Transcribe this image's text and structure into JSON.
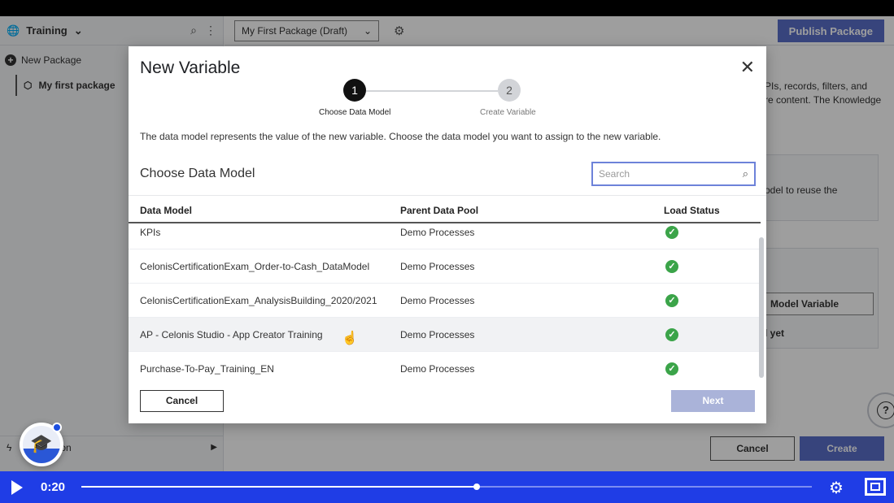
{
  "sidebar": {
    "workspace": "Training",
    "new_package": "New Package",
    "package_item": "My first package",
    "bottom_item": "on"
  },
  "topbar": {
    "package_select": "My First Package (Draft)",
    "publish": "Publish Package"
  },
  "background": {
    "text1a": "PIs, records, filters, and",
    "text1b": "re content. The Knowledge",
    "text2": "odel to reuse the",
    "model_variable_btn": "Model Variable",
    "empty_text": "l yet",
    "cancel": "Cancel",
    "create": "Create"
  },
  "modal": {
    "title": "New Variable",
    "steps": [
      {
        "num": "1",
        "label": "Choose Data Model"
      },
      {
        "num": "2",
        "label": "Create Variable"
      }
    ],
    "description": "The data model represents the value of the new variable. Choose the data model you want to assign to the new variable.",
    "subtitle": "Choose Data Model",
    "search_placeholder": "Search",
    "columns": [
      "Data Model",
      "Parent Data Pool",
      "Load Status"
    ],
    "rows": [
      {
        "model": "KPIs",
        "pool": "Demo Processes",
        "status": "loaded"
      },
      {
        "model": "CelonisCertificationExam_Order-to-Cash_DataModel",
        "pool": "Demo Processes",
        "status": "loaded"
      },
      {
        "model": "CelonisCertificationExam_AnalysisBuilding_2020/2021",
        "pool": "Demo Processes",
        "status": "loaded"
      },
      {
        "model": "AP - Celonis Studio - App Creator Training",
        "pool": "Demo Processes",
        "status": "loaded"
      },
      {
        "model": "Purchase-To-Pay_Training_EN",
        "pool": "Demo Processes",
        "status": "loaded"
      }
    ],
    "cancel": "Cancel",
    "next": "Next"
  },
  "video": {
    "time": "0:20",
    "progress": 0.541
  },
  "colors": {
    "accent": "#5a6ec8",
    "video_bar": "#1f3de6",
    "success": "#3ba449"
  }
}
